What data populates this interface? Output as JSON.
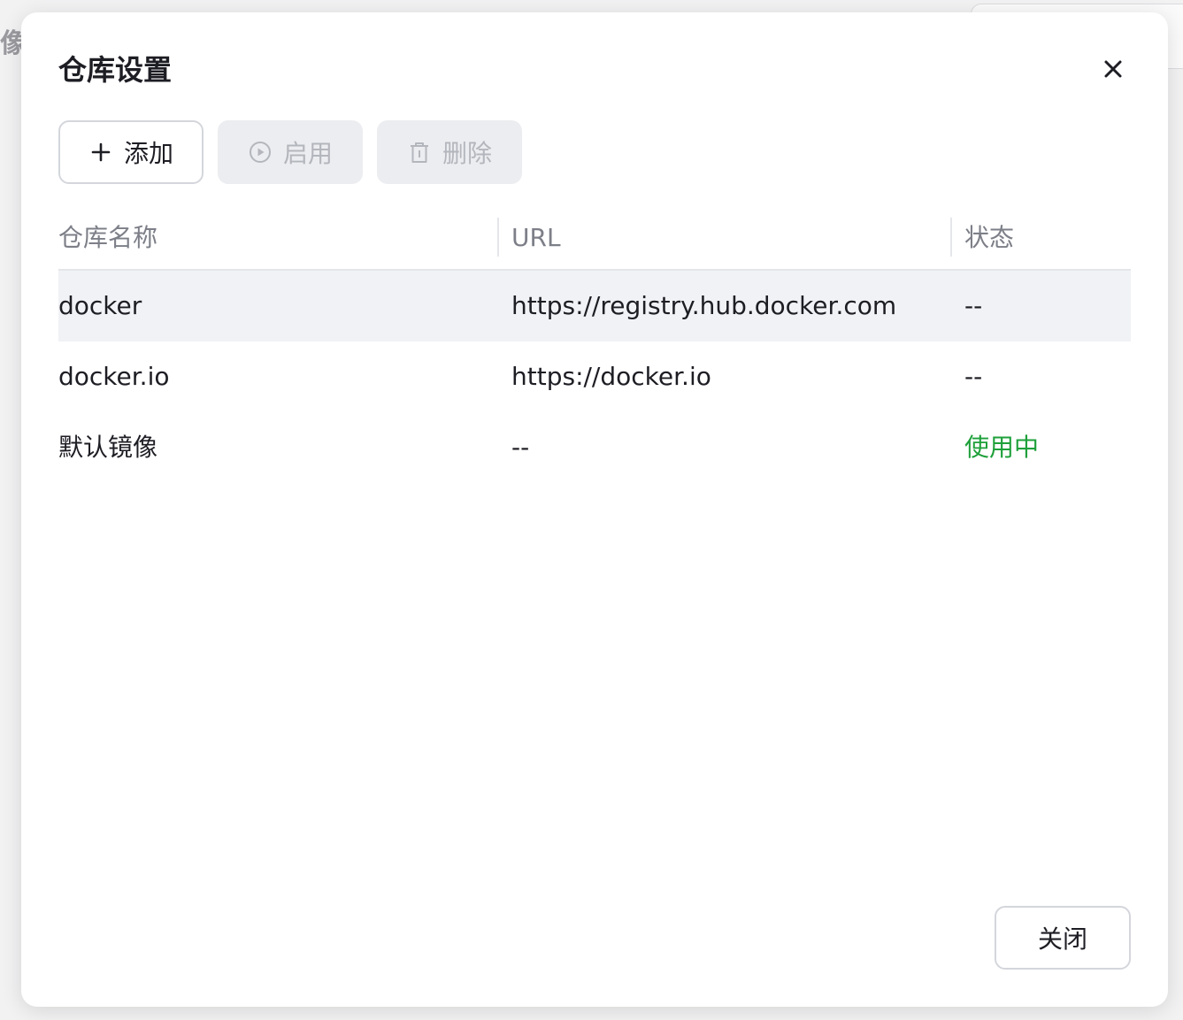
{
  "background": {
    "fragment_text": "像"
  },
  "dialog": {
    "title": "仓库设置",
    "close_icon": "close-icon"
  },
  "toolbar": {
    "add": {
      "label": "添加",
      "icon": "plus-icon",
      "enabled": true
    },
    "enable": {
      "label": "启用",
      "icon": "play-circle-icon",
      "enabled": false
    },
    "delete": {
      "label": "删除",
      "icon": "trash-icon",
      "enabled": false
    }
  },
  "table": {
    "columns": [
      "仓库名称",
      "URL",
      "状态"
    ],
    "rows": [
      {
        "name": "docker",
        "url": "https://registry.hub.docker.com",
        "status": "--",
        "selected": true
      },
      {
        "name": "docker.io",
        "url": "https://docker.io",
        "status": "--",
        "selected": false
      },
      {
        "name": "默认镜像",
        "url": "--",
        "status": "使用中",
        "selected": false
      }
    ]
  },
  "footer": {
    "close_label": "关闭"
  },
  "colors": {
    "status_active": "#1ea03a",
    "selected_row": "#f1f2f5",
    "disabled_button_bg": "#ecedf0"
  }
}
